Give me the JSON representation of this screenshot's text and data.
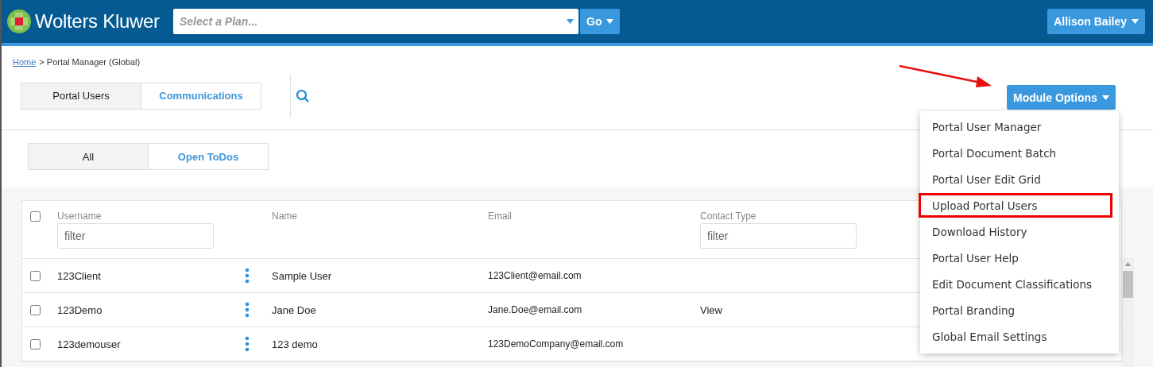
{
  "header": {
    "logo_text": "Wolters Kluwer",
    "plan_select": {
      "placeholder": "Select a Plan..."
    },
    "go_button": "Go",
    "user_menu": "Allison Bailey"
  },
  "breadcrumb": {
    "link": "Home",
    "current": "> Portal Manager (Global)"
  },
  "tabs": [
    {
      "label": "Portal Users",
      "selected": true
    },
    {
      "label": "Communications",
      "selected": false
    }
  ],
  "module_options": {
    "label": "Module Options",
    "expanded": true,
    "items": [
      {
        "label": "Portal User Manager",
        "annotated": false
      },
      {
        "label": "Portal Document Batch",
        "annotated": false
      },
      {
        "label": "Portal User Edit Grid",
        "annotated": false
      },
      {
        "label": "Upload Portal Users",
        "annotated": true
      },
      {
        "label": "Download History",
        "annotated": false
      },
      {
        "label": "Portal User Help",
        "annotated": false
      },
      {
        "label": "Edit Document Classifications",
        "annotated": false
      },
      {
        "label": "Portal Branding",
        "annotated": false
      },
      {
        "label": "Global Email Settings",
        "annotated": false
      }
    ]
  },
  "filters": [
    {
      "label": "All",
      "selected": true
    },
    {
      "label": "Open ToDos",
      "selected": false
    }
  ],
  "table": {
    "all_checked": false,
    "columns": [
      {
        "label": "Username",
        "filter_placeholder": "filter"
      },
      {
        "label": "Name"
      },
      {
        "label": "Email"
      },
      {
        "label": "Contact Type",
        "filter_placeholder": "filter"
      }
    ],
    "rows": [
      {
        "checked": false,
        "cells": [
          "123Client",
          "Sample User",
          "123Client@email.com",
          ""
        ]
      },
      {
        "checked": false,
        "cells": [
          "123Demo",
          "Jane Doe",
          "Jane.Doe@email.com",
          "View"
        ]
      },
      {
        "checked": false,
        "cells": [
          "123demouser",
          "123 demo",
          "123DemoCompany@email.com",
          ""
        ]
      }
    ]
  }
}
